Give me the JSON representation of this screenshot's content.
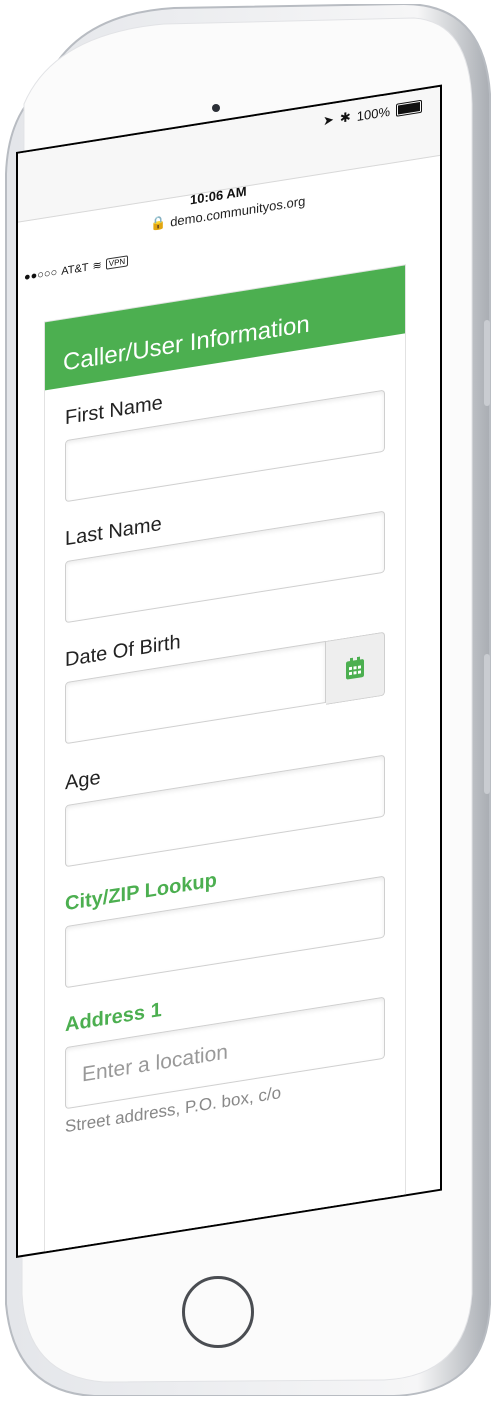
{
  "status_bar": {
    "signal": "●●○○○",
    "carrier": "AT&T",
    "vpn": "VPN",
    "time": "10:06 AM",
    "url": "demo.communityos.org",
    "battery": "100%"
  },
  "form": {
    "title": "Caller/User Information",
    "fields": [
      {
        "label": "First Name",
        "value": ""
      },
      {
        "label": "Last Name",
        "value": ""
      },
      {
        "label": "Date Of Birth",
        "value": ""
      },
      {
        "label": "Age",
        "value": ""
      }
    ],
    "city_zip": {
      "label": "City/ZIP Lookup",
      "value": ""
    },
    "address1": {
      "label": "Address 1",
      "placeholder": "Enter a location",
      "help": "Street address, P.O. box, c/o"
    }
  },
  "colors": {
    "accent": "#4caf50"
  }
}
